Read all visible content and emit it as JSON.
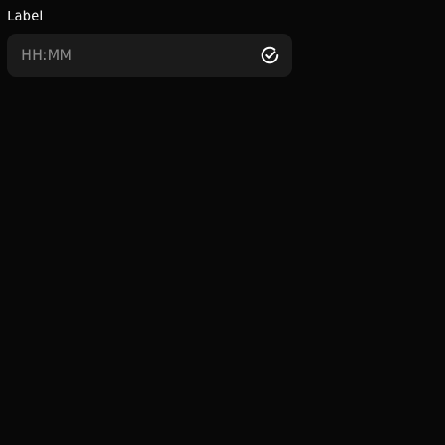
{
  "field": {
    "label": "Label",
    "value": "",
    "placeholder": "HH:MM",
    "trailing_icon": "check-circle-icon"
  },
  "colors": {
    "background": "#080808",
    "input_background": "#1b1b1b",
    "label_text": "#f2f2f2",
    "placeholder_text": "#8a8a8a",
    "icon": "#ffffff"
  }
}
